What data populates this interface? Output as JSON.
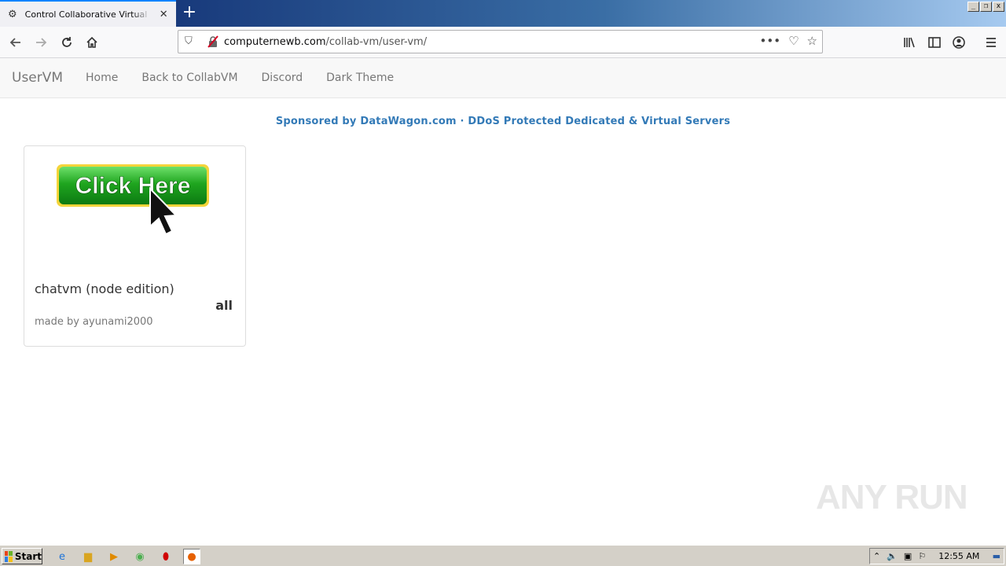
{
  "browser": {
    "tab_title": "Control Collaborative Virtual Machines",
    "url_host": "computernewb.com",
    "url_path": "/collab-vm/user-vm/"
  },
  "site": {
    "brand": "UserVM",
    "nav": [
      {
        "label": "Home"
      },
      {
        "label": "Back to CollabVM"
      },
      {
        "label": "Discord"
      },
      {
        "label": "Dark Theme"
      }
    ],
    "sponsor": "Sponsored by DataWagon.com · DDoS Protected Dedicated & Virtual Servers"
  },
  "vm_card": {
    "thumbnail_text": "Click Here",
    "name": "chatvm (node edition)",
    "tag": "all",
    "author": "made by ayunami2000"
  },
  "watermark": "ANY RUN",
  "taskbar": {
    "start_label": "Start",
    "clock": "12:55 AM"
  },
  "colors": {
    "link": "#337ab7",
    "nav_text": "#777777",
    "button_green": "#2fae2f"
  }
}
